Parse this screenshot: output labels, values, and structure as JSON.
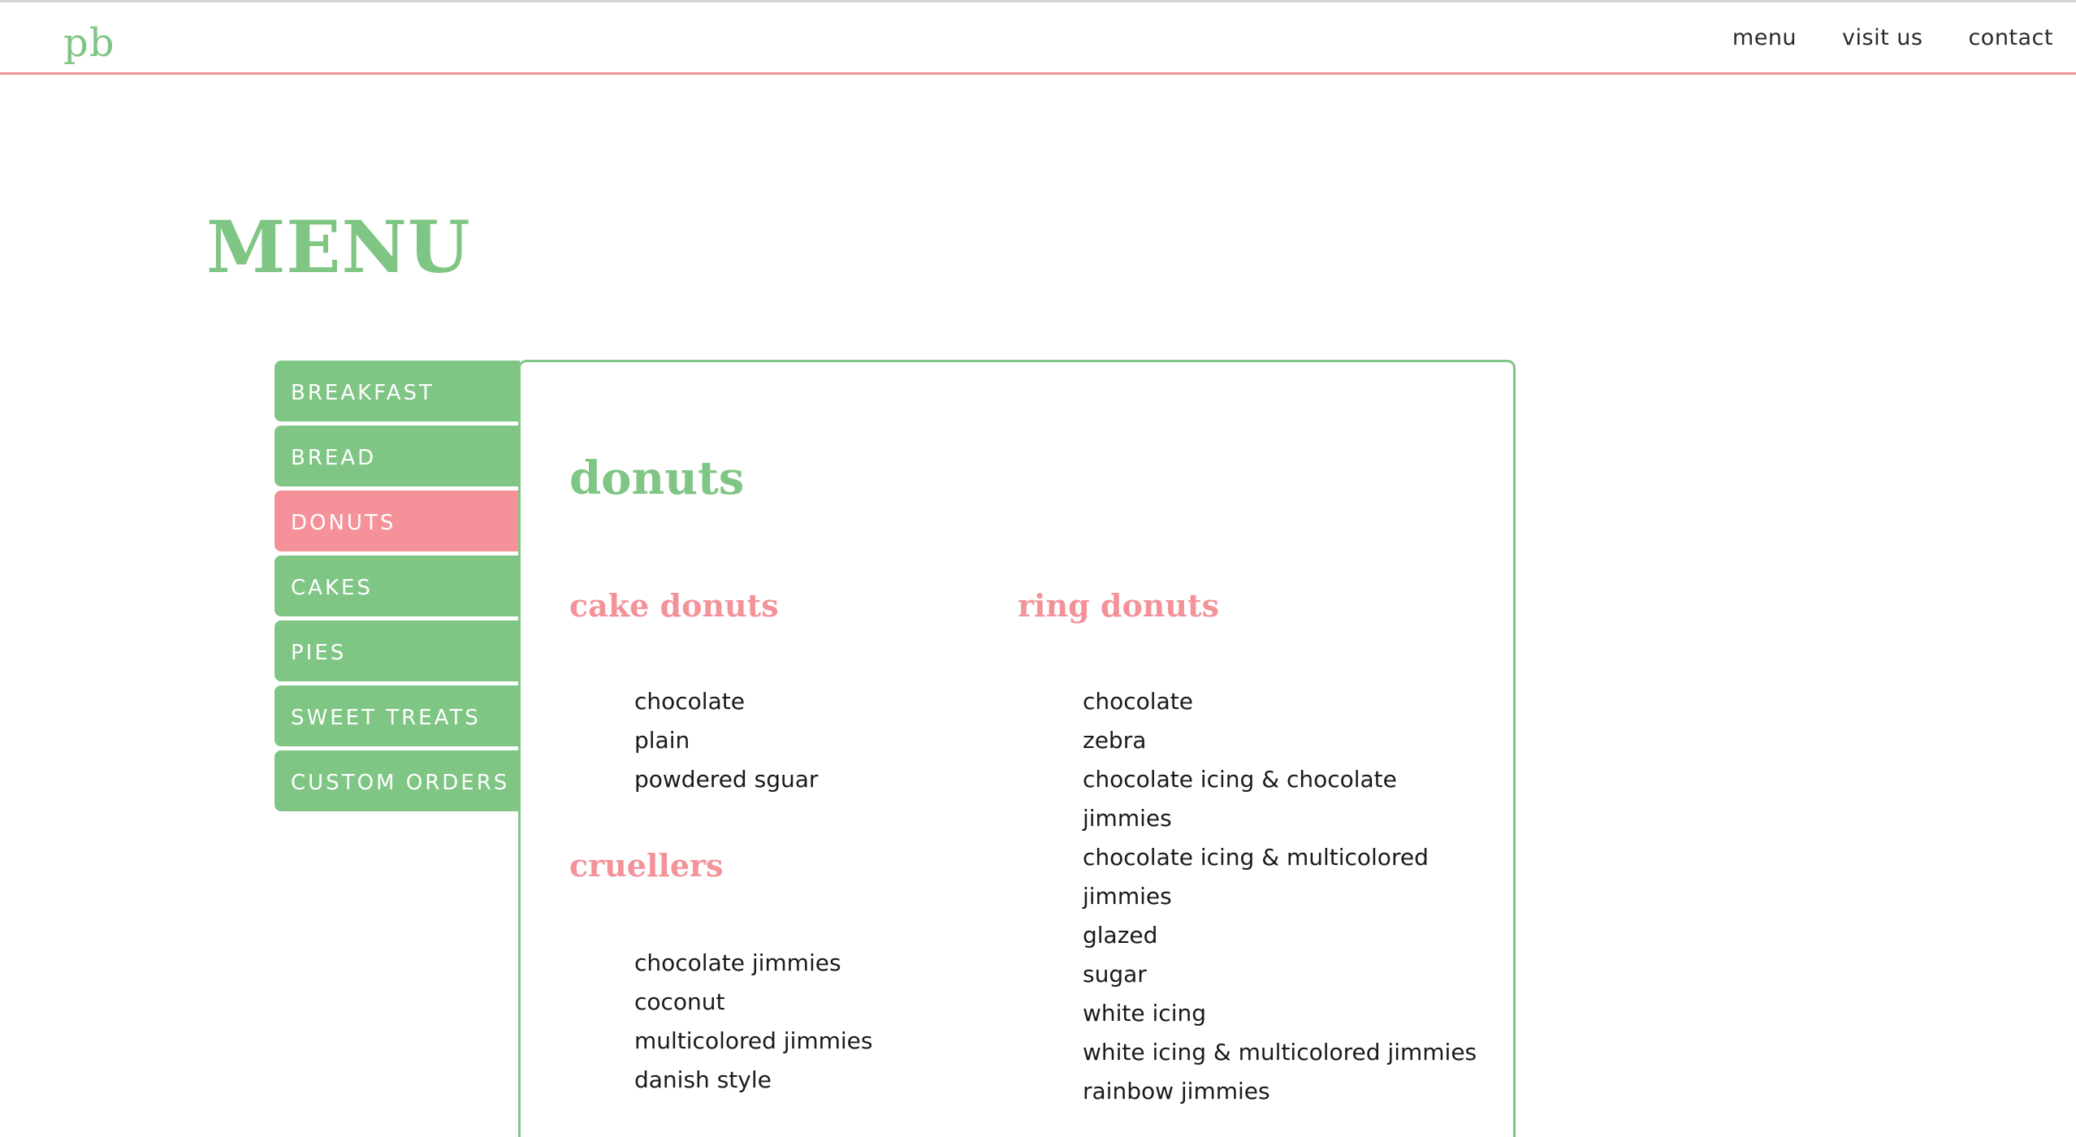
{
  "header": {
    "logo": "pb",
    "nav": [
      "menu",
      "visit us",
      "contact"
    ]
  },
  "page_title": "MENU",
  "categories": [
    "BREAKFAST",
    "BREAD",
    "DONUTS",
    "CAKES",
    "PIES",
    "SWEET TREATS",
    "CUSTOM ORDERS"
  ],
  "active_category": "DONUTS",
  "panel": {
    "title": "donuts",
    "sections": [
      {
        "title": "cake donuts",
        "items": [
          "chocolate",
          "plain",
          "powdered sguar"
        ]
      },
      {
        "title": "cruellers",
        "items": [
          "chocolate jimmies",
          "coconut",
          "multicolored jimmies",
          "danish style"
        ]
      },
      {
        "title": "ring donuts",
        "items": [
          "chocolate",
          "zebra",
          "chocolate icing & chocolate",
          "jimmies",
          "chocolate icing & multicolored",
          "jimmies",
          "glazed",
          "sugar",
          "white icing",
          "white icing & multicolored jimmies",
          "rainbow jimmies"
        ]
      }
    ]
  },
  "colors": {
    "green": "#7fc584",
    "pink": "#f4929a",
    "text": "#1a1a1a"
  }
}
